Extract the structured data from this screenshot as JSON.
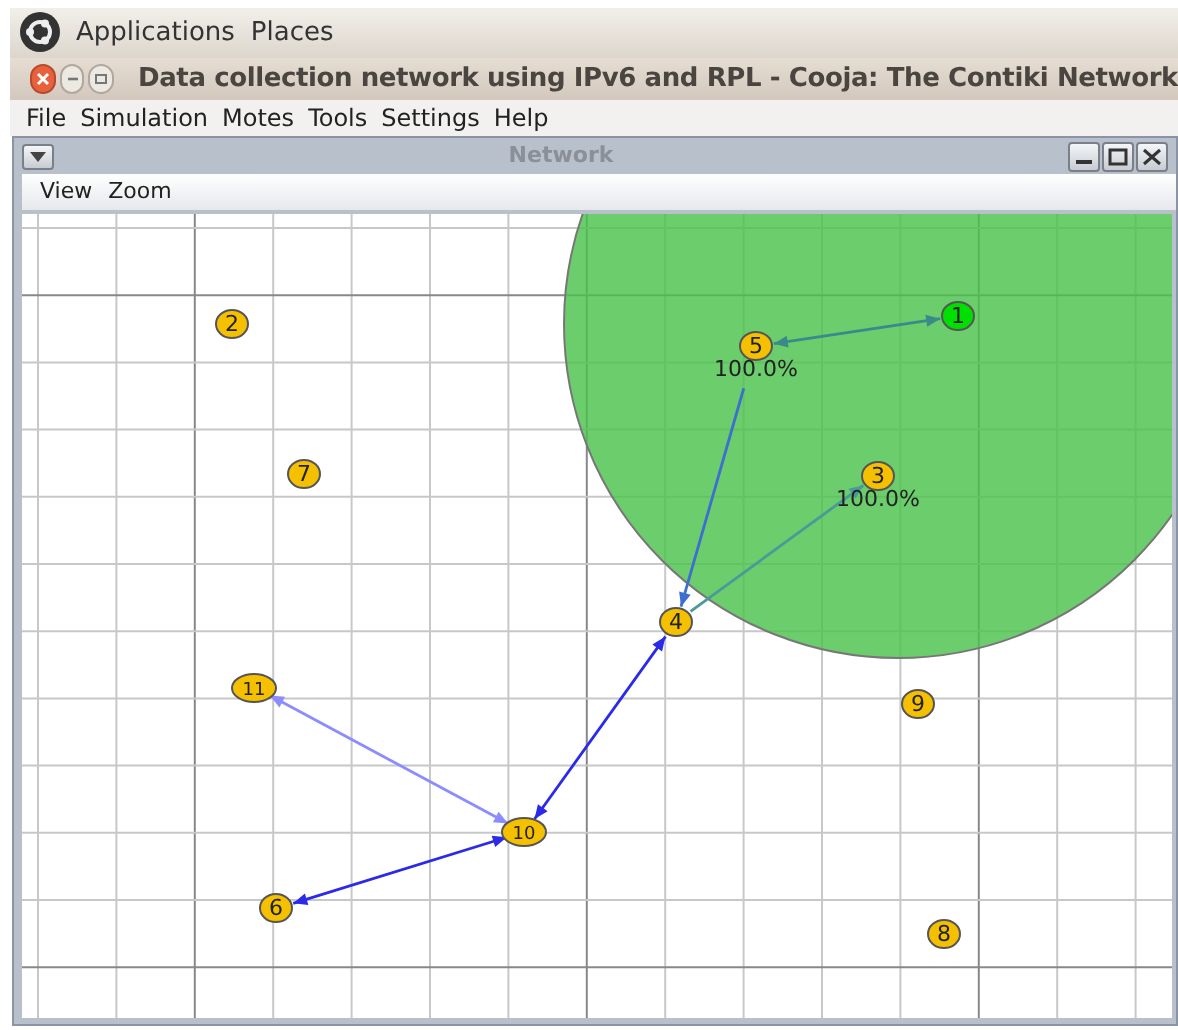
{
  "top_panel": {
    "items": [
      "Applications",
      "Places"
    ]
  },
  "window": {
    "title": "Data collection network using IPv6 and RPL - Cooja: The Contiki Network"
  },
  "menu": [
    "File",
    "Simulation",
    "Motes",
    "Tools",
    "Settings",
    "Help"
  ],
  "network_frame": {
    "title": "Network",
    "menu": [
      "View",
      "Zoom"
    ],
    "motes": [
      {
        "label": "2",
        "color": "#f5c000"
      },
      {
        "label": "7",
        "color": "#f5c000"
      },
      {
        "label": "5",
        "color": "#f5c000",
        "reading": "100.0%"
      },
      {
        "label": "1",
        "color": "#00e000"
      },
      {
        "label": "3",
        "color": "#f5c000",
        "reading": "100.0%"
      },
      {
        "label": "4",
        "color": "#f5c000"
      },
      {
        "label": "11",
        "color": "#f5c000"
      },
      {
        "label": "9",
        "color": "#f5c000"
      },
      {
        "label": "10",
        "color": "#f5c000"
      },
      {
        "label": "6",
        "color": "#f5c000"
      },
      {
        "label": "8",
        "color": "#f5c000"
      }
    ]
  }
}
